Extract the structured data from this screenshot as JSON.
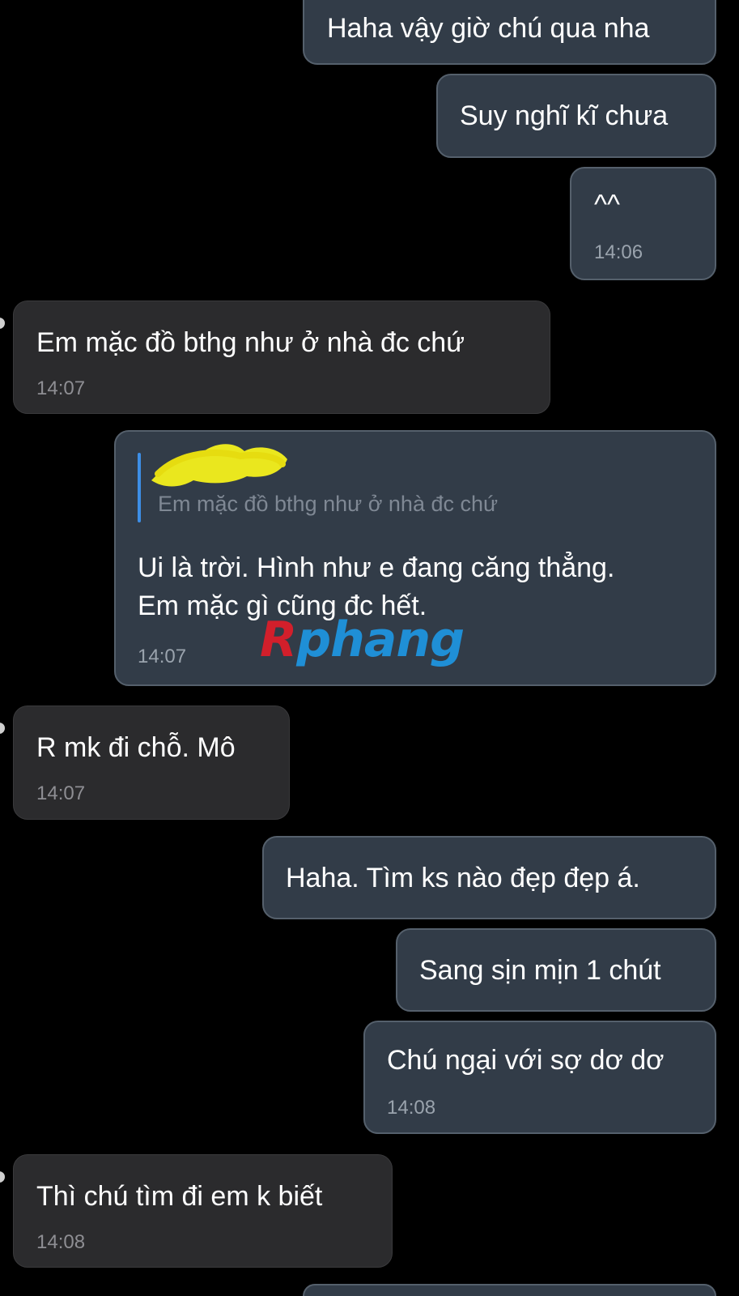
{
  "messages": [
    {
      "side": "out",
      "text": "Haha vậy giờ chú qua nha"
    },
    {
      "side": "out",
      "text": "Suy nghĩ kĩ chưa"
    },
    {
      "side": "out",
      "text": "^^",
      "time": "14:06"
    },
    {
      "side": "in",
      "text": "Em mặc đồ bthg như ở nhà đc chứ",
      "time": "14:07"
    },
    {
      "side": "out",
      "reply_to": "Em mặc đồ bthg như ở nhà đc chứ",
      "text_line1": "Ui là trời. Hình như e đang căng thẳng.",
      "text_line2": "Em mặc gì cũng đc hết.",
      "time": "14:07"
    },
    {
      "side": "in",
      "text": "R mk đi chỗ. Mô",
      "time": "14:07"
    },
    {
      "side": "out",
      "text": "Haha. Tìm ks nào đẹp đẹp á."
    },
    {
      "side": "out",
      "text": "Sang sịn mịn 1 chút"
    },
    {
      "side": "out",
      "text": "Chú ngại với sợ dơ dơ",
      "time": "14:08"
    },
    {
      "side": "in",
      "text": "Thì chú tìm đi em k biết",
      "time": "14:08"
    }
  ],
  "watermark": {
    "first": "R",
    "rest": "phang"
  },
  "colors": {
    "background": "#000000",
    "outgoing_bubble": "#323c48",
    "incoming_bubble": "#2b2b2d",
    "reply_accent": "#3d8ee6",
    "redaction": "#f4f01c"
  }
}
